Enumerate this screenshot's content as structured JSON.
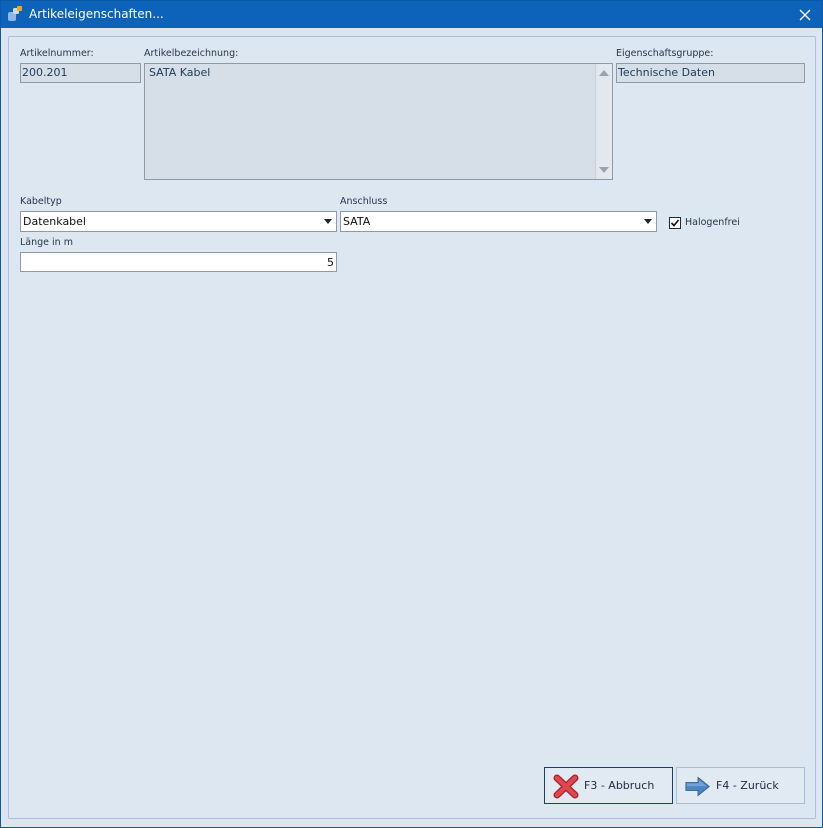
{
  "window": {
    "title": "Artikeleigenschaften..."
  },
  "fields": {
    "artikelnummer": {
      "label": "Artikelnummer:",
      "value": "200.201"
    },
    "artikelbezeichnung": {
      "label": "Artikelbezeichnung:",
      "value": "SATA Kabel"
    },
    "eigenschaftsgruppe": {
      "label": "Eigenschaftsgruppe:",
      "value": "Technische Daten"
    },
    "kabeltyp": {
      "label": "Kabeltyp",
      "value": "Datenkabel"
    },
    "anschluss": {
      "label": "Anschluss",
      "value": "SATA"
    },
    "halogenfrei": {
      "label": "Halogenfrei",
      "checked": true
    },
    "laenge": {
      "label": "Länge in m",
      "value": "5"
    }
  },
  "buttons": {
    "cancel": {
      "label": "F3 - Abbruch",
      "icon": "red-x-icon"
    },
    "back": {
      "label": "F4 - Zurück",
      "icon": "arrow-right-icon"
    }
  },
  "colors": {
    "titlebar": "#0c63b9",
    "background": "#dbe6f1",
    "cancel_icon": "#d9343a",
    "arrow_icon": "#3f7fbf"
  }
}
